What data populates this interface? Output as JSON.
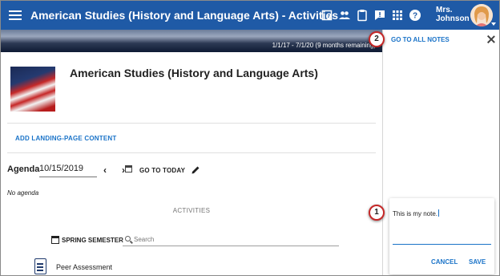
{
  "appbar": {
    "title": "American Studies (History and Language Arts) - Activities",
    "user_name": "Mrs. Johnson",
    "icons": [
      "notes-icon",
      "people-icon",
      "clipboard-icon",
      "feedback-icon",
      "apps-grid-icon",
      "help-icon"
    ]
  },
  "banner": {
    "dates": "1/1/17 - 7/1/20 (9 months remaining)"
  },
  "course": {
    "title": "American Studies (History and Language Arts)"
  },
  "main": {
    "add_content": "ADD LANDING-PAGE CONTENT",
    "agenda_label": "Agenda",
    "agenda_date": "10/15/2019",
    "go_today": "GO TO TODAY",
    "no_agenda": "No agenda",
    "activities_heading": "ACTIVITIES",
    "semester": "SPRING SEMESTER",
    "search_placeholder": "Search",
    "items": [
      {
        "label": "Peer Assessment"
      }
    ]
  },
  "notes_panel": {
    "go_all_notes": "GO TO ALL NOTES",
    "note_text": "This is my note.",
    "cancel": "CANCEL",
    "save": "SAVE"
  },
  "callouts": [
    "1",
    "2"
  ],
  "colors": {
    "appbar": "#1f5aa6",
    "accent": "#1a73c8",
    "callout_border": "#c62828"
  }
}
